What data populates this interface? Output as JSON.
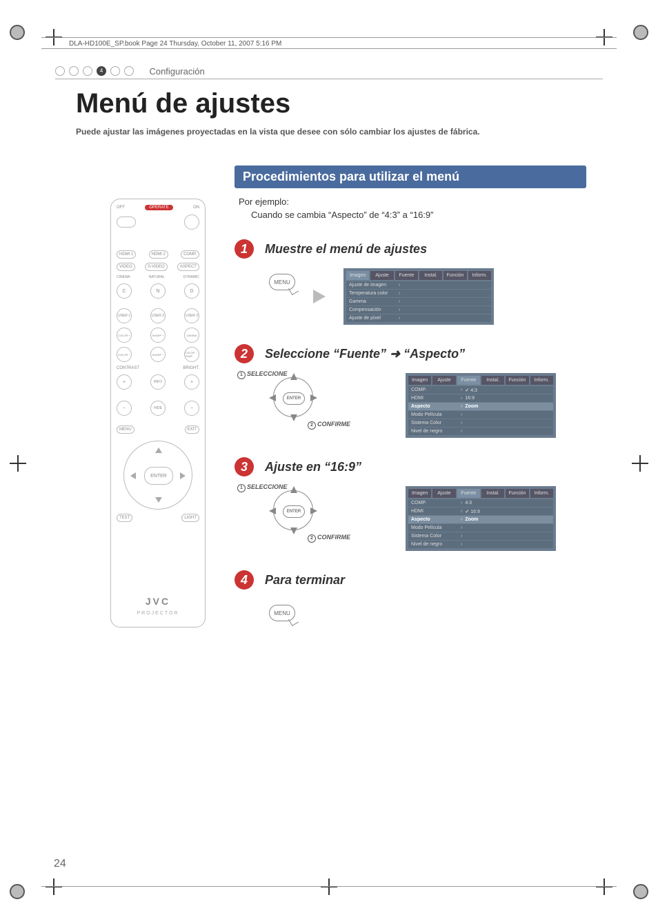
{
  "book_header": "DLA-HD100E_SP.book  Page 24  Thursday, October 11, 2007  5:16 PM",
  "section": {
    "number": "4",
    "label": "Configuración"
  },
  "title": "Menú de ajustes",
  "intro": "Puede ajustar las imágenes proyectadas en la vista que desee con sólo cambiar los ajustes de fábrica.",
  "proc_heading": "Procedimientos para utilizar el menú",
  "example_label": "Por ejemplo:",
  "example_text": "Cuando se cambia “Aspecto” de “4:3” a “16:9”",
  "steps": {
    "s1": {
      "title": "Muestre el menú de ajustes"
    },
    "s2": {
      "title": "Seleccione “Fuente” ➜ “Aspecto”"
    },
    "s3": {
      "title": "Ajuste en “16:9”"
    },
    "s4": {
      "title": "Para terminar"
    }
  },
  "callouts": {
    "select": "SELECCIONE",
    "confirm": "CONFIRME",
    "n1": "1",
    "n2": "2"
  },
  "menu_btn": "MENU",
  "enter_btn": "ENTER",
  "osd": {
    "tabs": [
      "Imagen",
      "Ajuste",
      "Fuente",
      "Instal.",
      "Función",
      "Inform."
    ],
    "img_rows": [
      "Ajuste de imagen",
      "Temperatura color",
      "Gamma",
      "Compensación",
      "Ajuste de píxel"
    ],
    "src_rows": [
      "COMP.",
      "HDMI",
      "Aspecto",
      "Modo Película",
      "Sistema Color",
      "Nivel de negro"
    ],
    "aspect_vals": [
      "4:3",
      "16:9",
      "Zoom"
    ],
    "aspect_sel1": "4:3",
    "aspect_sel2": "16:9"
  },
  "remote": {
    "off": "OFF",
    "on": "ON",
    "operate": "OPERATE",
    "row1": [
      "HDMI 1",
      "HDMI 2",
      "COMP."
    ],
    "row2": [
      "VIDEO",
      "S-VIDEO",
      "ASPECT"
    ],
    "row2b": [
      "CINEMA",
      "NATURAL",
      "DYNAMIC"
    ],
    "row3": [
      "C",
      "N",
      "D"
    ],
    "row4": [
      "USER 1",
      "USER 2",
      "USER 3"
    ],
    "row5": [
      "COLOR +",
      "SHARP +",
      "GAMMA"
    ],
    "row6": [
      "COLOR −",
      "SHARP −",
      "COLOR TEMP"
    ],
    "contrast": "CONTRAST",
    "bright": "BRIGHT.",
    "info": "INFO",
    "hide": "HIDE",
    "menu": "MENU",
    "exit": "EXIT",
    "test": "TEST",
    "light": "LIGHT",
    "brand": "JVC",
    "brand_sub": "PROJECTOR"
  },
  "page_number": "24"
}
